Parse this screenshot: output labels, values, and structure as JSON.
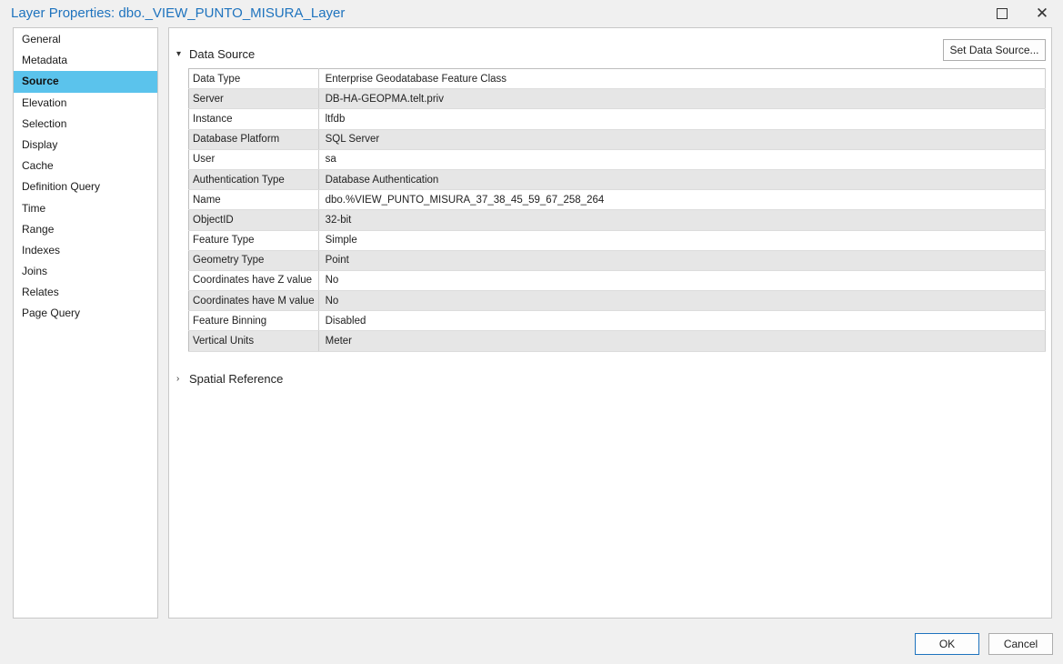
{
  "window": {
    "title": "Layer Properties: dbo._VIEW_PUNTO_MISURA_Layer",
    "maximize_icon": "maximize-icon",
    "close_icon": "close-icon",
    "close_glyph": "✕"
  },
  "sidebar": {
    "items": [
      {
        "label": "General"
      },
      {
        "label": "Metadata"
      },
      {
        "label": "Source",
        "active": true
      },
      {
        "label": "Elevation"
      },
      {
        "label": "Selection"
      },
      {
        "label": "Display"
      },
      {
        "label": "Cache"
      },
      {
        "label": "Definition Query"
      },
      {
        "label": "Time"
      },
      {
        "label": "Range"
      },
      {
        "label": "Indexes"
      },
      {
        "label": "Joins"
      },
      {
        "label": "Relates"
      },
      {
        "label": "Page Query"
      }
    ],
    "active_color": "#5bc3ec"
  },
  "main": {
    "data_source": {
      "heading": "Data Source",
      "expanded": true,
      "set_button": "Set Data Source...",
      "rows": [
        {
          "key": "Data Type",
          "value": "Enterprise Geodatabase Feature Class"
        },
        {
          "key": "Server",
          "value": "DB-HA-GEOPMA.telt.priv"
        },
        {
          "key": "Instance",
          "value": "ltfdb"
        },
        {
          "key": "Database Platform",
          "value": "SQL Server"
        },
        {
          "key": "User",
          "value": "sa"
        },
        {
          "key": "Authentication Type",
          "value": "Database Authentication"
        },
        {
          "key": "Name",
          "value": "dbo.%VIEW_PUNTO_MISURA_37_38_45_59_67_258_264"
        },
        {
          "key": "ObjectID",
          "value": "32-bit"
        },
        {
          "key": "Feature Type",
          "value": "Simple"
        },
        {
          "key": "Geometry Type",
          "value": "Point"
        },
        {
          "key": "Coordinates have Z value",
          "value": "No"
        },
        {
          "key": "Coordinates have M value",
          "value": "No"
        },
        {
          "key": "Feature Binning",
          "value": "Disabled"
        },
        {
          "key": "Vertical Units",
          "value": "Meter"
        }
      ]
    },
    "spatial_reference": {
      "heading": "Spatial Reference",
      "expanded": false
    },
    "chevron_expanded": "▾",
    "chevron_collapsed": "›"
  },
  "footer": {
    "ok": "OK",
    "cancel": "Cancel"
  },
  "colors": {
    "title": "#1e73be",
    "accent": "#5bc3ec"
  }
}
